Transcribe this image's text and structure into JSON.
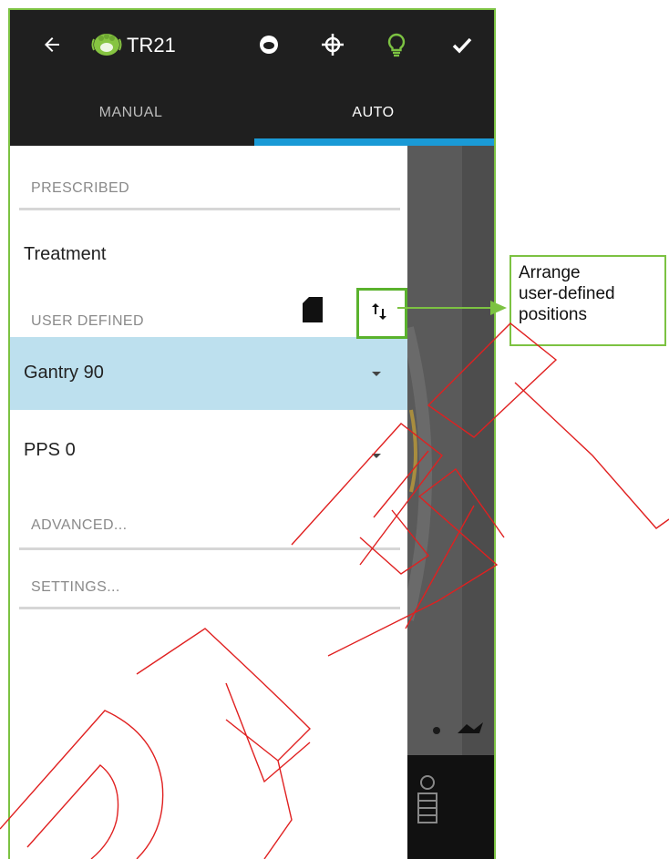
{
  "app_title": "TR21",
  "topbar": {
    "back_icon": "back-arrow-icon",
    "logo_icon": "green-hand-logo-icon",
    "ring_icon": "ring-icon",
    "crosshair_icon": "crosshair-icon",
    "lightbulb_icon": "lightbulb-icon",
    "check_icon": "checkmark-icon"
  },
  "tabs": [
    {
      "label": "MANUAL"
    },
    {
      "label": "AUTO",
      "selected": true
    }
  ],
  "drawer": {
    "prescribed_label": "PRESCRIBED",
    "treatment_label": "Treatment",
    "user_defined_label": "USER DEFINED",
    "items": [
      {
        "label": "Gantry 90",
        "selected": true
      },
      {
        "label": "PPS 0"
      }
    ],
    "advanced_label": "ADVANCED...",
    "settings_label": "SETTINGS..."
  },
  "callout": {
    "text_lines": [
      "Arrange",
      "user-defined",
      "positions"
    ]
  },
  "colors": {
    "accent_green": "#7cc242",
    "tab_indicator": "#1a9ad6",
    "selected_row": "#bde0ee",
    "watermark_red": "#e02020"
  }
}
